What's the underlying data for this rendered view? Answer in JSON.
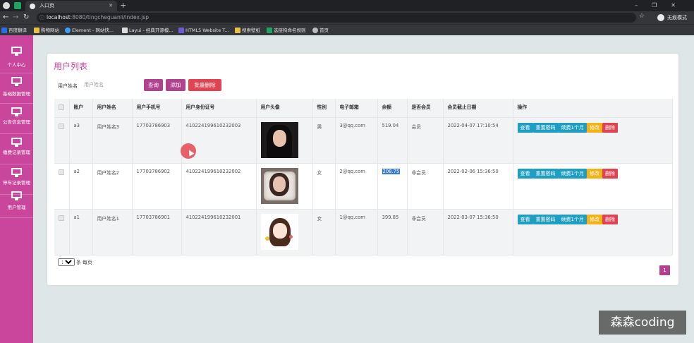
{
  "browser": {
    "tab_title": "入口页",
    "url_host": "localhost",
    "url_path": ":8080/tingcheguanli/index.jsp",
    "incognito_label": "无痕模式",
    "bookmarks": [
      {
        "label": "百度翻译",
        "icon": "translate-icon",
        "color": "#2b6de8"
      },
      {
        "label": "购物网站",
        "icon": "folder-icon",
        "color": "#e8c046"
      },
      {
        "label": "Element - 网站快...",
        "icon": "element-icon",
        "color": "#409eff"
      },
      {
        "label": "Layui - 经典开源模...",
        "icon": "layui-icon",
        "color": "#dddddd"
      },
      {
        "label": "HTML5 Website T...",
        "icon": "html5-icon",
        "color": "#6b5bd4"
      },
      {
        "label": "搜索壁纸",
        "icon": "folder-icon",
        "color": "#e8c046"
      },
      {
        "label": "选链狗命名规则",
        "icon": "sheet-icon",
        "color": "#1ea362"
      },
      {
        "label": "首页",
        "icon": "globe-icon",
        "color": "#bbbbbb"
      }
    ]
  },
  "sidebar": {
    "items": [
      {
        "label": "个人中心"
      },
      {
        "label": "基础数据管理"
      },
      {
        "label": "公告信息管理"
      },
      {
        "label": "缴费记录管理"
      },
      {
        "label": "停车记录管理"
      },
      {
        "label": "用户管理"
      }
    ]
  },
  "main": {
    "title": "用户列表",
    "search_label": "用户姓名",
    "search_placeholder": "用户姓名",
    "buttons": {
      "query": "查询",
      "add": "添加",
      "batch_delete": "批量删除"
    },
    "columns": [
      "",
      "账户",
      "用户姓名",
      "用户手机号",
      "用户身份证号",
      "用户头像",
      "性别",
      "电子邮箱",
      "余额",
      "是否会员",
      "会员截止日期",
      "操作"
    ],
    "rows": [
      {
        "account": "a3",
        "name": "用户姓名3",
        "phone": "17703786903",
        "id_number": "410224199610232003",
        "gender": "男",
        "email": "3@qq.com",
        "balance": "519.04",
        "member": "会员",
        "expire": "2022-04-07 17:10:54"
      },
      {
        "account": "a2",
        "name": "用户姓名2",
        "phone": "17703786902",
        "id_number": "410224199610232002",
        "gender": "女",
        "email": "2@qq.com",
        "balance": "208.75",
        "member": "非会员",
        "expire": "2022-02-06 15:36:50"
      },
      {
        "account": "a1",
        "name": "用户姓名1",
        "phone": "17703786901",
        "id_number": "410224199610232001",
        "gender": "女",
        "email": "1@qq.com",
        "balance": "399.85",
        "member": "非会员",
        "expire": "2022-03-07 15:36:50"
      }
    ],
    "ops": {
      "view": "查看",
      "reset": "重置密码",
      "renew": "续费1个月",
      "edit": "修改",
      "delete": "删除"
    },
    "page_size": "10",
    "page_size_suffix": "条 每页",
    "current_page": "1"
  },
  "watermark": "森森coding",
  "colors": {
    "accent": "#c9469c",
    "button": "#b0428f",
    "danger": "#e04453",
    "info": "#1f9ec2",
    "warning": "#f2b21a"
  }
}
